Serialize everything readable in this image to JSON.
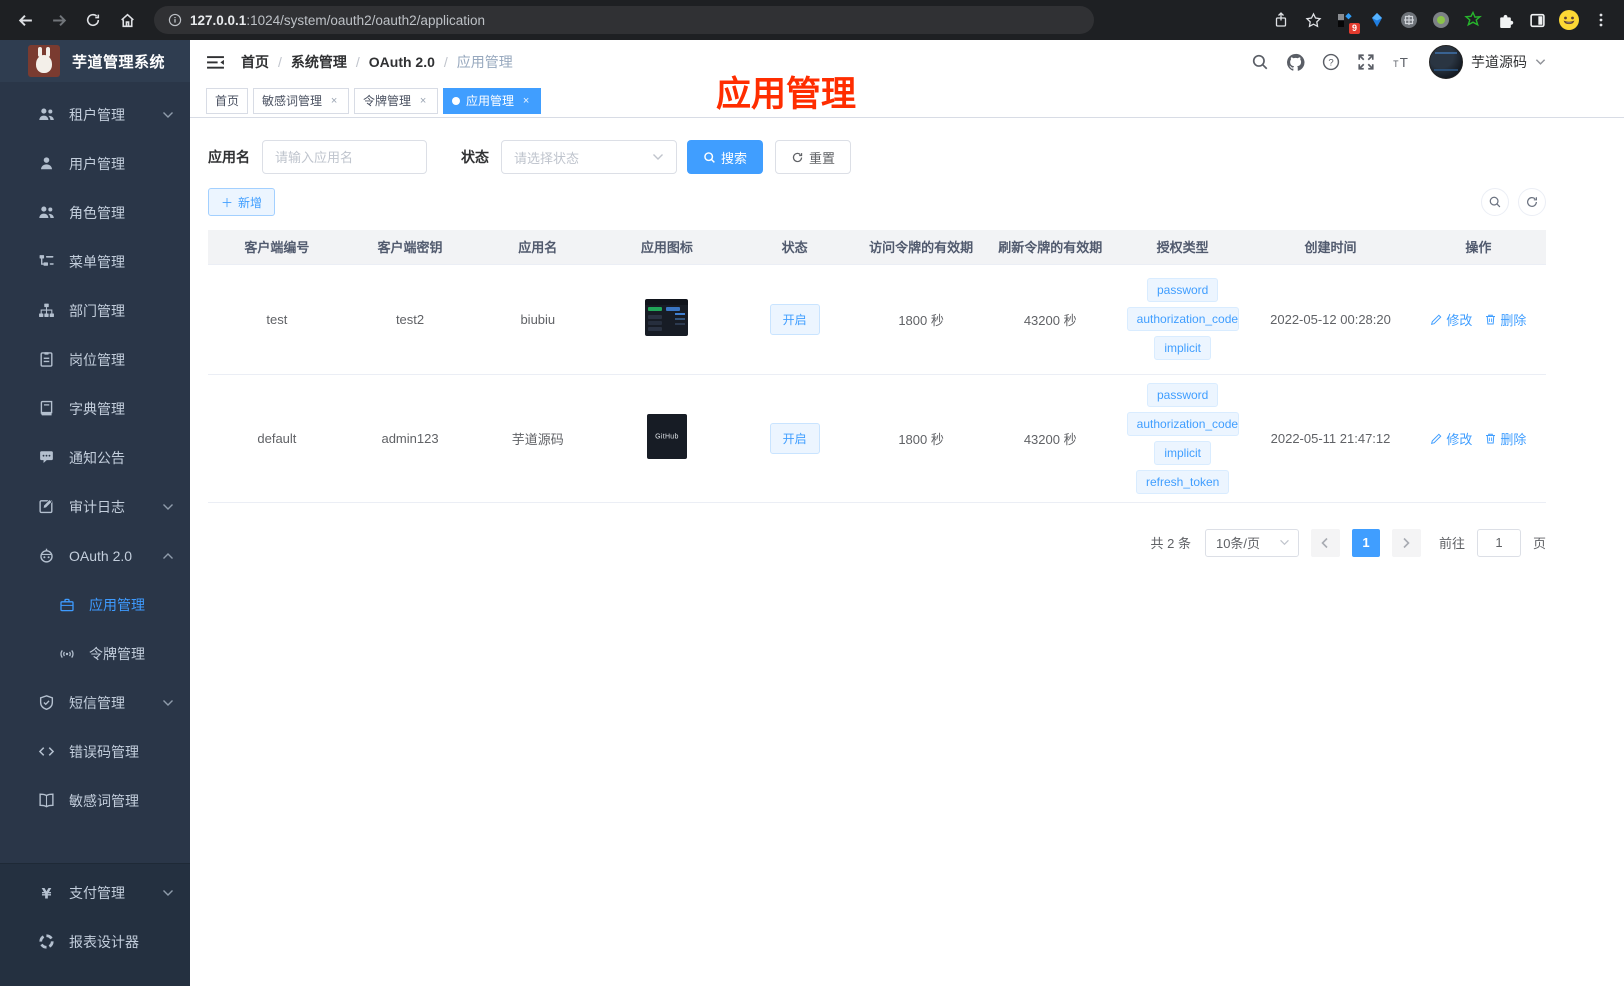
{
  "browser": {
    "url_host": "127.0.0.1",
    "url_path": ":1024/system/oauth2/oauth2/application",
    "extension_badge": "9"
  },
  "sidebar": {
    "title": "芋道管理系统",
    "items": [
      {
        "name": "tenant",
        "icon": "users-icon",
        "label": "租户管理",
        "arrow": "down"
      },
      {
        "name": "user",
        "icon": "user-icon",
        "label": "用户管理"
      },
      {
        "name": "role",
        "icon": "role-users-icon",
        "label": "角色管理"
      },
      {
        "name": "menu",
        "icon": "menu-tree-icon",
        "label": "菜单管理"
      },
      {
        "name": "dept",
        "icon": "sitemap-icon",
        "label": "部门管理"
      },
      {
        "name": "post",
        "icon": "id-badge-icon",
        "label": "岗位管理"
      },
      {
        "name": "dict",
        "icon": "dictionary-icon",
        "label": "字典管理"
      },
      {
        "name": "notice",
        "icon": "announcement-icon",
        "label": "通知公告"
      },
      {
        "name": "audit",
        "icon": "audit-log-icon",
        "label": "审计日志",
        "arrow": "down"
      },
      {
        "name": "oauth2",
        "icon": "robot-icon",
        "label": "OAuth 2.0",
        "arrow": "up",
        "children": [
          {
            "name": "application",
            "icon": "briefcase-icon",
            "label": "应用管理",
            "active": true
          },
          {
            "name": "token",
            "icon": "broadcast-icon",
            "label": "令牌管理"
          }
        ]
      },
      {
        "name": "sms",
        "icon": "shield-check-icon",
        "label": "短信管理",
        "arrow": "down"
      },
      {
        "name": "errorcode",
        "icon": "code-icon",
        "label": "错误码管理"
      },
      {
        "name": "sensitiveword",
        "icon": "open-book-icon",
        "label": "敏感词管理"
      },
      {
        "name": "pay",
        "icon": "yen-icon",
        "label": "支付管理",
        "arrow": "down",
        "section": 2
      },
      {
        "name": "report",
        "icon": "report-icon",
        "label": "报表设计器",
        "section": 2
      }
    ]
  },
  "navbar": {
    "breadcrumb": [
      {
        "label": "首页",
        "muted": false
      },
      {
        "label": "系统管理",
        "muted": false
      },
      {
        "label": "OAuth 2.0",
        "muted": false
      },
      {
        "label": "应用管理",
        "muted": true
      }
    ],
    "username": "芋道源码"
  },
  "tabs": [
    {
      "label": "首页",
      "closable": false,
      "active": false
    },
    {
      "label": "敏感词管理",
      "closable": true,
      "active": false
    },
    {
      "label": "令牌管理",
      "closable": true,
      "active": false
    },
    {
      "label": "应用管理",
      "closable": true,
      "active": true
    }
  ],
  "annotation": {
    "text": "应用管理",
    "color": "#ff2d00"
  },
  "filter": {
    "app_name_label": "应用名",
    "app_name_placeholder": "请输入应用名",
    "status_label": "状态",
    "status_placeholder": "请选择状态",
    "search_label": "搜索",
    "reset_label": "重置"
  },
  "toolbar": {
    "add_label": "新增"
  },
  "table": {
    "columns": [
      "客户端编号",
      "客户端密钥",
      "应用名",
      "应用图标",
      "状态",
      "访问令牌的有效期",
      "刷新令牌的有效期",
      "授权类型",
      "创建时间",
      "操作"
    ],
    "edit_label": "修改",
    "delete_label": "删除",
    "rows": [
      {
        "client_id": "test",
        "client_secret": "test2",
        "app_name": "biubiu",
        "icon_kind": "dashboard-screenshot",
        "icon_text": "",
        "status": "开启",
        "access_token_validity": "1800 秒",
        "refresh_token_validity": "43200 秒",
        "grant_types": [
          "password",
          "authorization_code",
          "implicit"
        ],
        "create_time": "2022-05-12 00:28:20"
      },
      {
        "client_id": "default",
        "client_secret": "admin123",
        "app_name": "芋道源码",
        "icon_kind": "github-dark",
        "icon_text": "GitHub",
        "status": "开启",
        "access_token_validity": "1800 秒",
        "refresh_token_validity": "43200 秒",
        "grant_types": [
          "password",
          "authorization_code",
          "implicit",
          "refresh_token"
        ],
        "create_time": "2022-05-11 21:47:12"
      }
    ]
  },
  "pagination": {
    "total": "共 2 条",
    "page_size": "10条/页",
    "current": "1",
    "goto_label": "前往",
    "goto_value": "1",
    "page_unit": "页"
  },
  "colors": {
    "accent": "#409eff",
    "annotation": "#ff2d00"
  }
}
